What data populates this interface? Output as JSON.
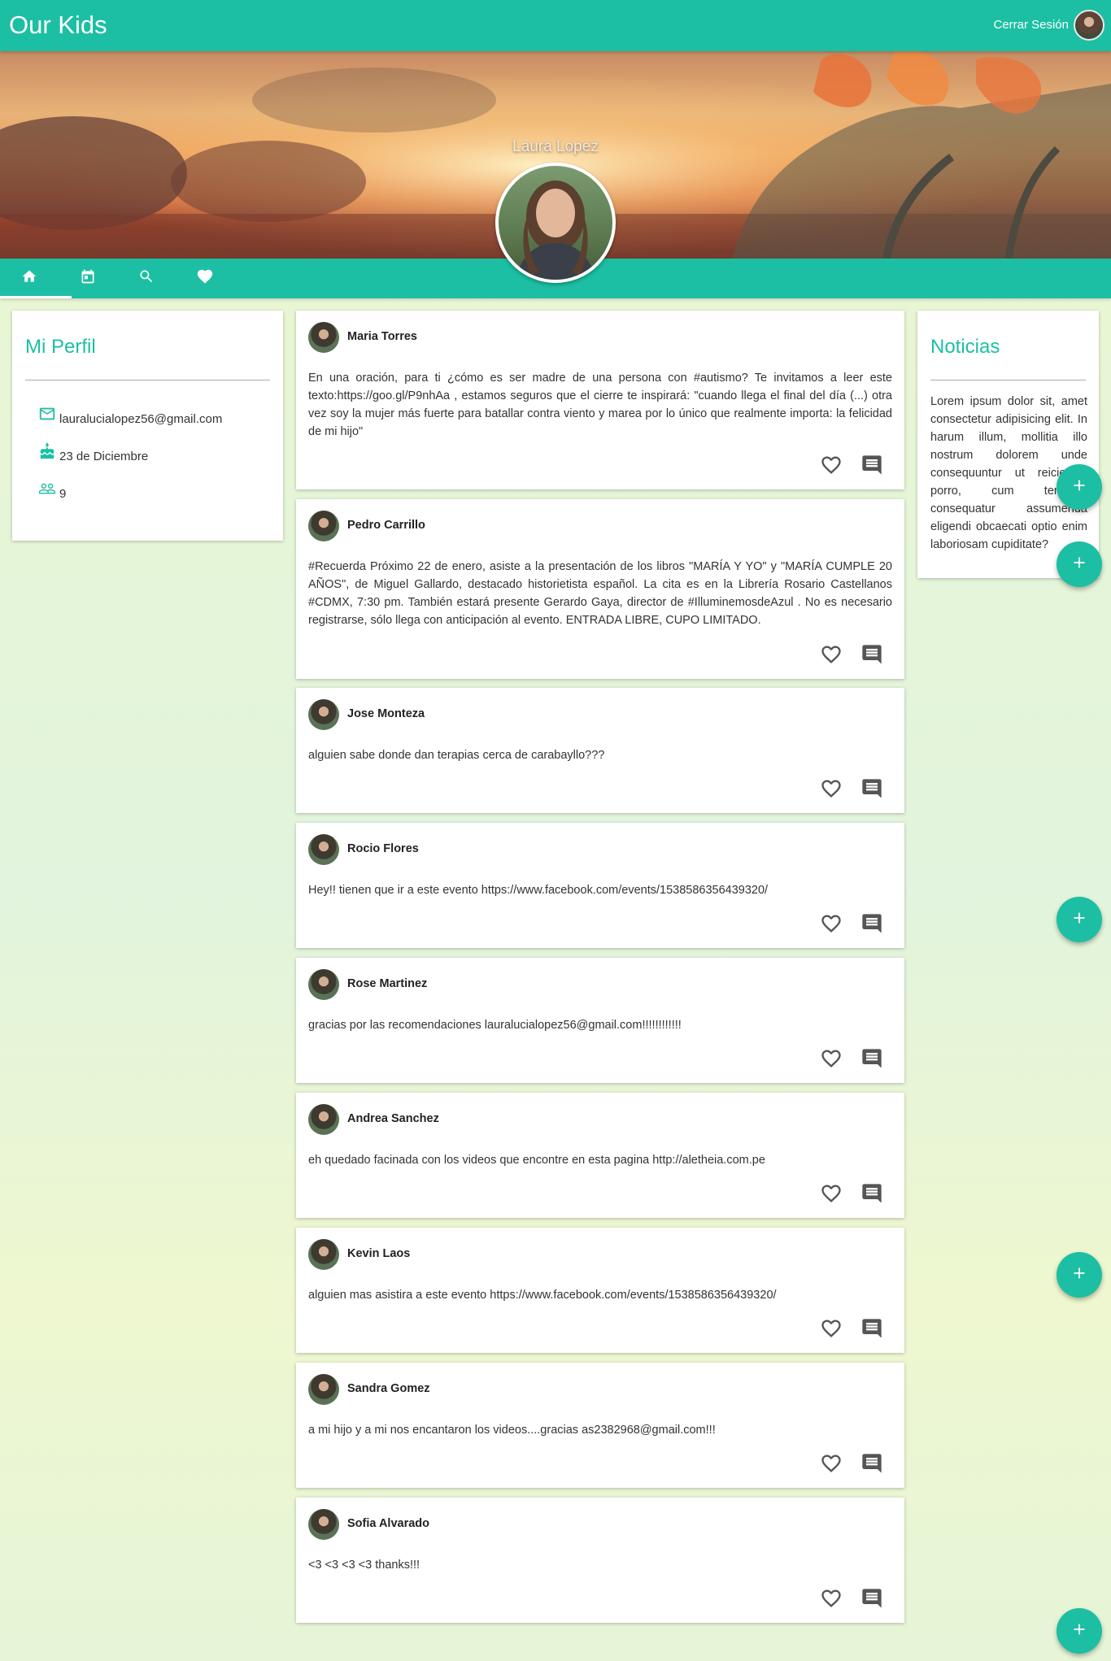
{
  "app": {
    "title": "Our Kids",
    "logout_label": "Cerrar Sesión"
  },
  "profile": {
    "name": "Laura Lopez",
    "email": "lauralucialopez56@gmail.com",
    "birthday": "23 de Diciembre",
    "friends_count": "9"
  },
  "tabs": [
    {
      "name": "home",
      "icon": "home-icon"
    },
    {
      "name": "calendar",
      "icon": "calendar-icon"
    },
    {
      "name": "search",
      "icon": "search-icon"
    },
    {
      "name": "favorites",
      "icon": "heart-icon"
    }
  ],
  "left_card": {
    "title": "Mi Perfil"
  },
  "news_card": {
    "title": "Noticias",
    "text": "Lorem ipsum dolor sit, amet consectetur adipisicing elit. In harum illum, mollitia illo nostrum dolorem unde consequuntur ut reiciendis porro, cum tempore consequatur assumenda eligendi obcaecati optio enim laboriosam cupiditate?"
  },
  "posts": [
    {
      "author": "Maria Torres",
      "text": "En una oración, para ti ¿cómo es ser madre de una persona con #autismo? Te invitamos a leer este texto:https://goo.gl/P9nhAa , estamos seguros que el cierre te inspirará: \"cuando llega el final del día (...) otra vez soy la mujer más fuerte para batallar contra viento y marea por lo único que realmente importa: la felicidad de mi hijo\""
    },
    {
      "author": "Pedro Carrillo",
      "text": "#Recuerda Próximo 22 de enero, asiste a la presentación de los libros \"MARÍA Y YO\" y \"MARÍA CUMPLE 20 AÑOS\", de Miguel Gallardo, destacado historietista español. La cita es en la Librería Rosario Castellanos #CDMX, 7:30 pm. También estará presente Gerardo Gaya, director de #IlluminemosdeAzul . No es necesario registrarse, sólo llega con anticipación al evento. ENTRADA LIBRE, CUPO LIMITADO."
    },
    {
      "author": "Jose Monteza",
      "text": "alguien sabe donde dan terapias cerca de carabayllo???"
    },
    {
      "author": "Rocio Flores",
      "text": "Hey!! tienen que ir a este evento https://www.facebook.com/events/1538586356439320/"
    },
    {
      "author": "Rose Martinez",
      "text": "gracias por las recomendaciones lauralucialopez56@gmail.com!!!!!!!!!!!!"
    },
    {
      "author": "Andrea Sanchez",
      "text": "eh quedado facinada con los videos que encontre en esta pagina http://aletheia.com.pe"
    },
    {
      "author": "Kevin Laos",
      "text": "alguien mas asistira a este evento https://www.facebook.com/events/1538586356439320/"
    },
    {
      "author": "Sandra Gomez",
      "text": "a mi hijo y a mi nos encantaron los videos....gracias as2382968@gmail.com!!!"
    },
    {
      "author": "Sofia Alvarado",
      "text": "<3 <3 <3 <3 thanks!!!"
    }
  ],
  "colors": {
    "primary": "#1cbfa3",
    "icon_gray": "#555555"
  }
}
